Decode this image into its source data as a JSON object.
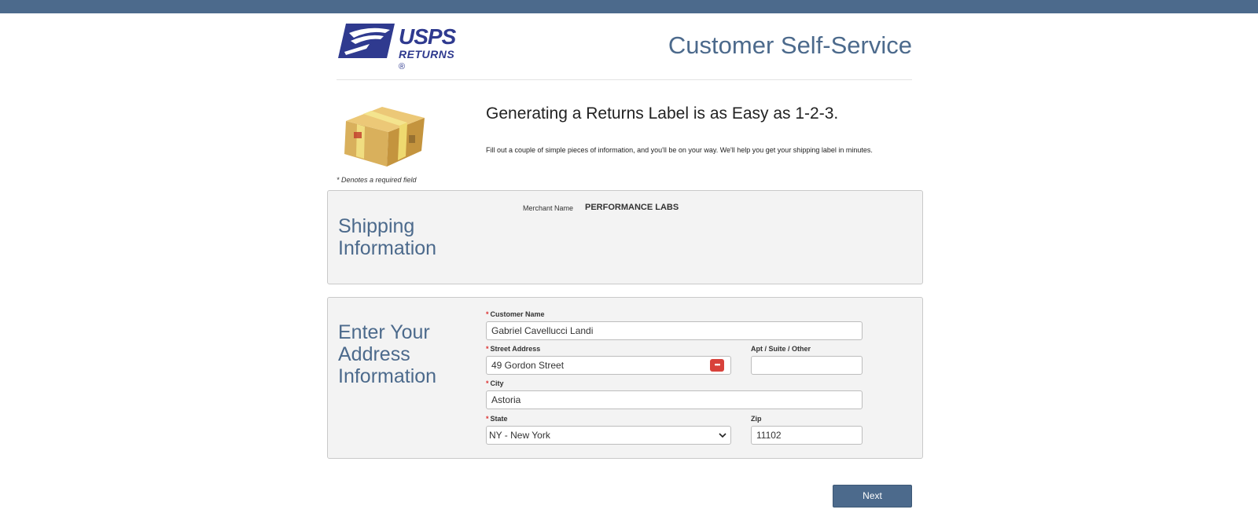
{
  "header": {
    "logo_usps": "USPS",
    "logo_returns": "RETURNS",
    "logo_reg": "®",
    "page_title": "Customer Self-Service"
  },
  "intro": {
    "headline": "Generating a Returns Label is as Easy as 1-2-3.",
    "subline": "Fill out a couple of simple pieces of information, and you'll be on your way. We'll help you get your shipping label in minutes.",
    "required_note": "* Denotes a required field",
    "package_icon": "package-box-image"
  },
  "shipping": {
    "heading": "Shipping Information",
    "merchant_label": "Merchant Name",
    "merchant_value": "PERFORMANCE LABS"
  },
  "address": {
    "heading": "Enter Your Address Information",
    "required_marker": "*",
    "customer_name_label": "Customer Name",
    "customer_name_value": "Gabriel Cavellucci Landi",
    "street_label": "Street Address",
    "street_value": "49 Gordon Street",
    "street_icon": "password-manager-icon",
    "apt_label": "Apt / Suite / Other",
    "apt_value": "",
    "city_label": "City",
    "city_value": "Astoria",
    "state_label": "State",
    "state_value": "NY - New York",
    "zip_label": "Zip",
    "zip_value": "11102"
  },
  "actions": {
    "next_label": "Next"
  },
  "colors": {
    "brand_blue": "#4c6a8c",
    "logo_navy": "#2f3a8f",
    "required_red": "#d33"
  }
}
